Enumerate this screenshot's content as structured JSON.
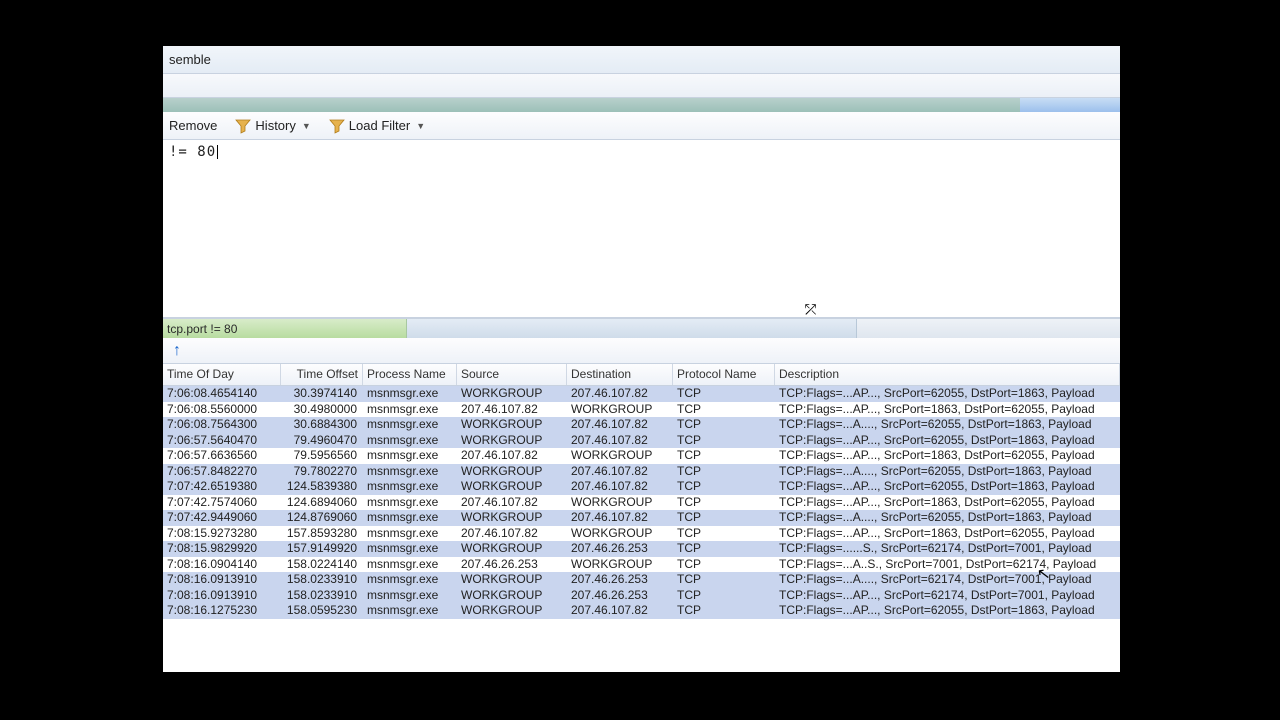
{
  "menubar": {
    "item0": "semble"
  },
  "toolbar": {
    "remove": "Remove",
    "history": "History",
    "loadfilter": "Load Filter"
  },
  "filter_editor": {
    "text": "  != 80"
  },
  "statusbar": {
    "applied": " tcp.port != 80"
  },
  "columns": {
    "time": "Time Of Day",
    "offset": "Time Offset",
    "process": "Process Name",
    "source": "Source",
    "destination": "Destination",
    "protocol": "Protocol Name",
    "description": "Description"
  },
  "rows": [
    {
      "sel": true,
      "time": "7:06:08.4654140",
      "off": "30.3974140",
      "proc": "msnmsgr.exe",
      "src": "WORKGROUP",
      "dst": "207.46.107.82",
      "prot": "TCP",
      "desc": "TCP:Flags=...AP..., SrcPort=62055, DstPort=1863, Payload"
    },
    {
      "sel": false,
      "time": "7:06:08.5560000",
      "off": "30.4980000",
      "proc": "msnmsgr.exe",
      "src": "207.46.107.82",
      "dst": "WORKGROUP",
      "prot": "TCP",
      "desc": "TCP:Flags=...AP..., SrcPort=1863, DstPort=62055, Payload"
    },
    {
      "sel": true,
      "time": "7:06:08.7564300",
      "off": "30.6884300",
      "proc": "msnmsgr.exe",
      "src": "WORKGROUP",
      "dst": "207.46.107.82",
      "prot": "TCP",
      "desc": "TCP:Flags=...A...., SrcPort=62055, DstPort=1863, Payload"
    },
    {
      "sel": true,
      "time": "7:06:57.5640470",
      "off": "79.4960470",
      "proc": "msnmsgr.exe",
      "src": "WORKGROUP",
      "dst": "207.46.107.82",
      "prot": "TCP",
      "desc": "TCP:Flags=...AP..., SrcPort=62055, DstPort=1863, Payload"
    },
    {
      "sel": false,
      "time": "7:06:57.6636560",
      "off": "79.5956560",
      "proc": "msnmsgr.exe",
      "src": "207.46.107.82",
      "dst": "WORKGROUP",
      "prot": "TCP",
      "desc": "TCP:Flags=...AP..., SrcPort=1863, DstPort=62055, Payload"
    },
    {
      "sel": true,
      "time": "7:06:57.8482270",
      "off": "79.7802270",
      "proc": "msnmsgr.exe",
      "src": "WORKGROUP",
      "dst": "207.46.107.82",
      "prot": "TCP",
      "desc": "TCP:Flags=...A...., SrcPort=62055, DstPort=1863, Payload"
    },
    {
      "sel": true,
      "time": "7:07:42.6519380",
      "off": "124.5839380",
      "proc": "msnmsgr.exe",
      "src": "WORKGROUP",
      "dst": "207.46.107.82",
      "prot": "TCP",
      "desc": "TCP:Flags=...AP..., SrcPort=62055, DstPort=1863, Payload"
    },
    {
      "sel": false,
      "time": "7:07:42.7574060",
      "off": "124.6894060",
      "proc": "msnmsgr.exe",
      "src": "207.46.107.82",
      "dst": "WORKGROUP",
      "prot": "TCP",
      "desc": "TCP:Flags=...AP..., SrcPort=1863, DstPort=62055, Payload"
    },
    {
      "sel": true,
      "time": "7:07:42.9449060",
      "off": "124.8769060",
      "proc": "msnmsgr.exe",
      "src": "WORKGROUP",
      "dst": "207.46.107.82",
      "prot": "TCP",
      "desc": "TCP:Flags=...A...., SrcPort=62055, DstPort=1863, Payload"
    },
    {
      "sel": false,
      "time": "7:08:15.9273280",
      "off": "157.8593280",
      "proc": "msnmsgr.exe",
      "src": "207.46.107.82",
      "dst": "WORKGROUP",
      "prot": "TCP",
      "desc": "TCP:Flags=...AP..., SrcPort=1863, DstPort=62055, Payload"
    },
    {
      "sel": true,
      "time": "7:08:15.9829920",
      "off": "157.9149920",
      "proc": "msnmsgr.exe",
      "src": "WORKGROUP",
      "dst": "207.46.26.253",
      "prot": "TCP",
      "desc": "TCP:Flags=......S., SrcPort=62174, DstPort=7001, Payload"
    },
    {
      "sel": false,
      "time": "7:08:16.0904140",
      "off": "158.0224140",
      "proc": "msnmsgr.exe",
      "src": "207.46.26.253",
      "dst": "WORKGROUP",
      "prot": "TCP",
      "desc": "TCP:Flags=...A..S., SrcPort=7001, DstPort=62174, Payload"
    },
    {
      "sel": true,
      "time": "7:08:16.0913910",
      "off": "158.0233910",
      "proc": "msnmsgr.exe",
      "src": "WORKGROUP",
      "dst": "207.46.26.253",
      "prot": "TCP",
      "desc": "TCP:Flags=...A...., SrcPort=62174, DstPort=7001, Payload"
    },
    {
      "sel": true,
      "time": "7:08:16.0913910",
      "off": "158.0233910",
      "proc": "msnmsgr.exe",
      "src": "WORKGROUP",
      "dst": "207.46.26.253",
      "prot": "TCP",
      "desc": "TCP:Flags=...AP..., SrcPort=62174, DstPort=7001, Payload"
    },
    {
      "sel": true,
      "time": "7:08:16.1275230",
      "off": "158.0595230",
      "proc": "msnmsgr.exe",
      "src": "WORKGROUP",
      "dst": "207.46.107.82",
      "prot": "TCP",
      "desc": "TCP:Flags=...AP..., SrcPort=62055, DstPort=1863, Payload"
    }
  ]
}
